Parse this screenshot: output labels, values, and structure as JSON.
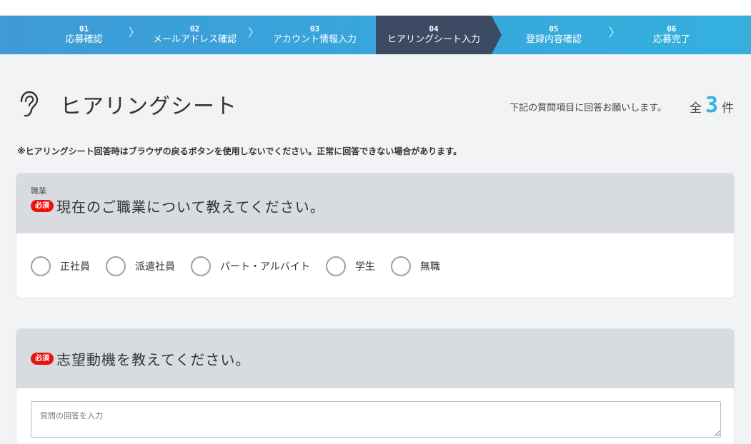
{
  "steps": [
    {
      "num": "01",
      "label": "応募確認"
    },
    {
      "num": "02",
      "label": "メールアドレス確認"
    },
    {
      "num": "03",
      "label": "アカウント情報入力"
    },
    {
      "num": "04",
      "label": "ヒアリングシート入力"
    },
    {
      "num": "05",
      "label": "登録内容確認"
    },
    {
      "num": "06",
      "label": "応募完了"
    }
  ],
  "step_separator": "〉",
  "page": {
    "title": "ヒアリングシート",
    "instructions": "下記の質問項目に回答お願いします。",
    "count_prefix": "全",
    "count": "3",
    "count_suffix": "件",
    "warning": "※ヒアリングシート回答時はブラウザの戻るボタンを使用しないでください。正常に回答できない場合があります。"
  },
  "questions": [
    {
      "category": "職業",
      "required": "必須",
      "text": "現在のご職業について教えてください。",
      "options": [
        "正社員",
        "派遣社員",
        "パート・アルバイト",
        "学生",
        "無職"
      ]
    },
    {
      "required": "必須",
      "text": "志望動機を教えてください。",
      "placeholder": "質問の回答を入力"
    }
  ],
  "colors": {
    "step_bar": "#36a7dc",
    "step_active": "#3c4a63",
    "required_badge": "#e8140c",
    "count_accent": "#2cb5e0"
  }
}
